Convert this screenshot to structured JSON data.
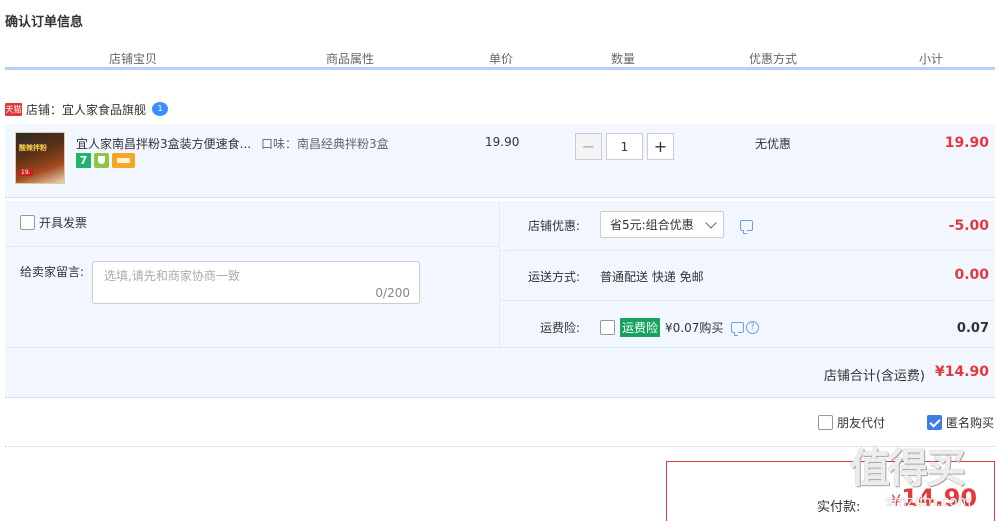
{
  "page": {
    "title": "确认订单信息"
  },
  "columns": [
    "店铺宝贝",
    "商品属性",
    "单价",
    "数量",
    "优惠方式",
    "小计"
  ],
  "shop": {
    "badge": "天猫",
    "label": "店铺：宜人家食品旗舰",
    "chat_badge": "1"
  },
  "item": {
    "thumb_text1": "酸辣拌粉",
    "thumb_text2": "19.",
    "title": "宜人家南昌拌粉3盒装方便速食...",
    "icon_seven": "7",
    "attr": "口味：南昌经典拌粉3盒",
    "price": "19.90",
    "quantity": "1",
    "minus": "−",
    "plus": "+",
    "discount": "无优惠",
    "subtotal": "19.90"
  },
  "order": {
    "invoice_label": "开具发票",
    "memo_label": "给卖家留言:",
    "memo_placeholder": "选填,请先和商家协商一致",
    "memo_count": "0/200",
    "shop_discount_label": "店铺优惠:",
    "shop_discount_value": "省5元:组合优惠",
    "shop_discount_amount": "-5.00",
    "shipping_label": "运送方式:",
    "shipping_value": "普通配送 快递 免邮",
    "shipping_amount": "0.00",
    "insurance_label": "运费险:",
    "insurance_tag": "运费险",
    "insurance_value": "¥0.07购买",
    "insurance_amount": "0.07",
    "shop_total_label": "店铺合计(含运费)",
    "shop_total_value": "¥14.90"
  },
  "options": {
    "friend_pay": "朋友代付",
    "anonymous": "匿名购买",
    "anonymous_checked": true
  },
  "payment": {
    "label": "实付款:",
    "currency": "¥",
    "amount": "14.90"
  },
  "watermark": {
    "big": "值得买",
    "small": "smzdm.com"
  },
  "colors": {
    "accent_red": "#e4393c",
    "header_bar": "#b2d1ff",
    "panel_bg": "#f2f7ff",
    "link_blue": "#3d7ce6"
  }
}
